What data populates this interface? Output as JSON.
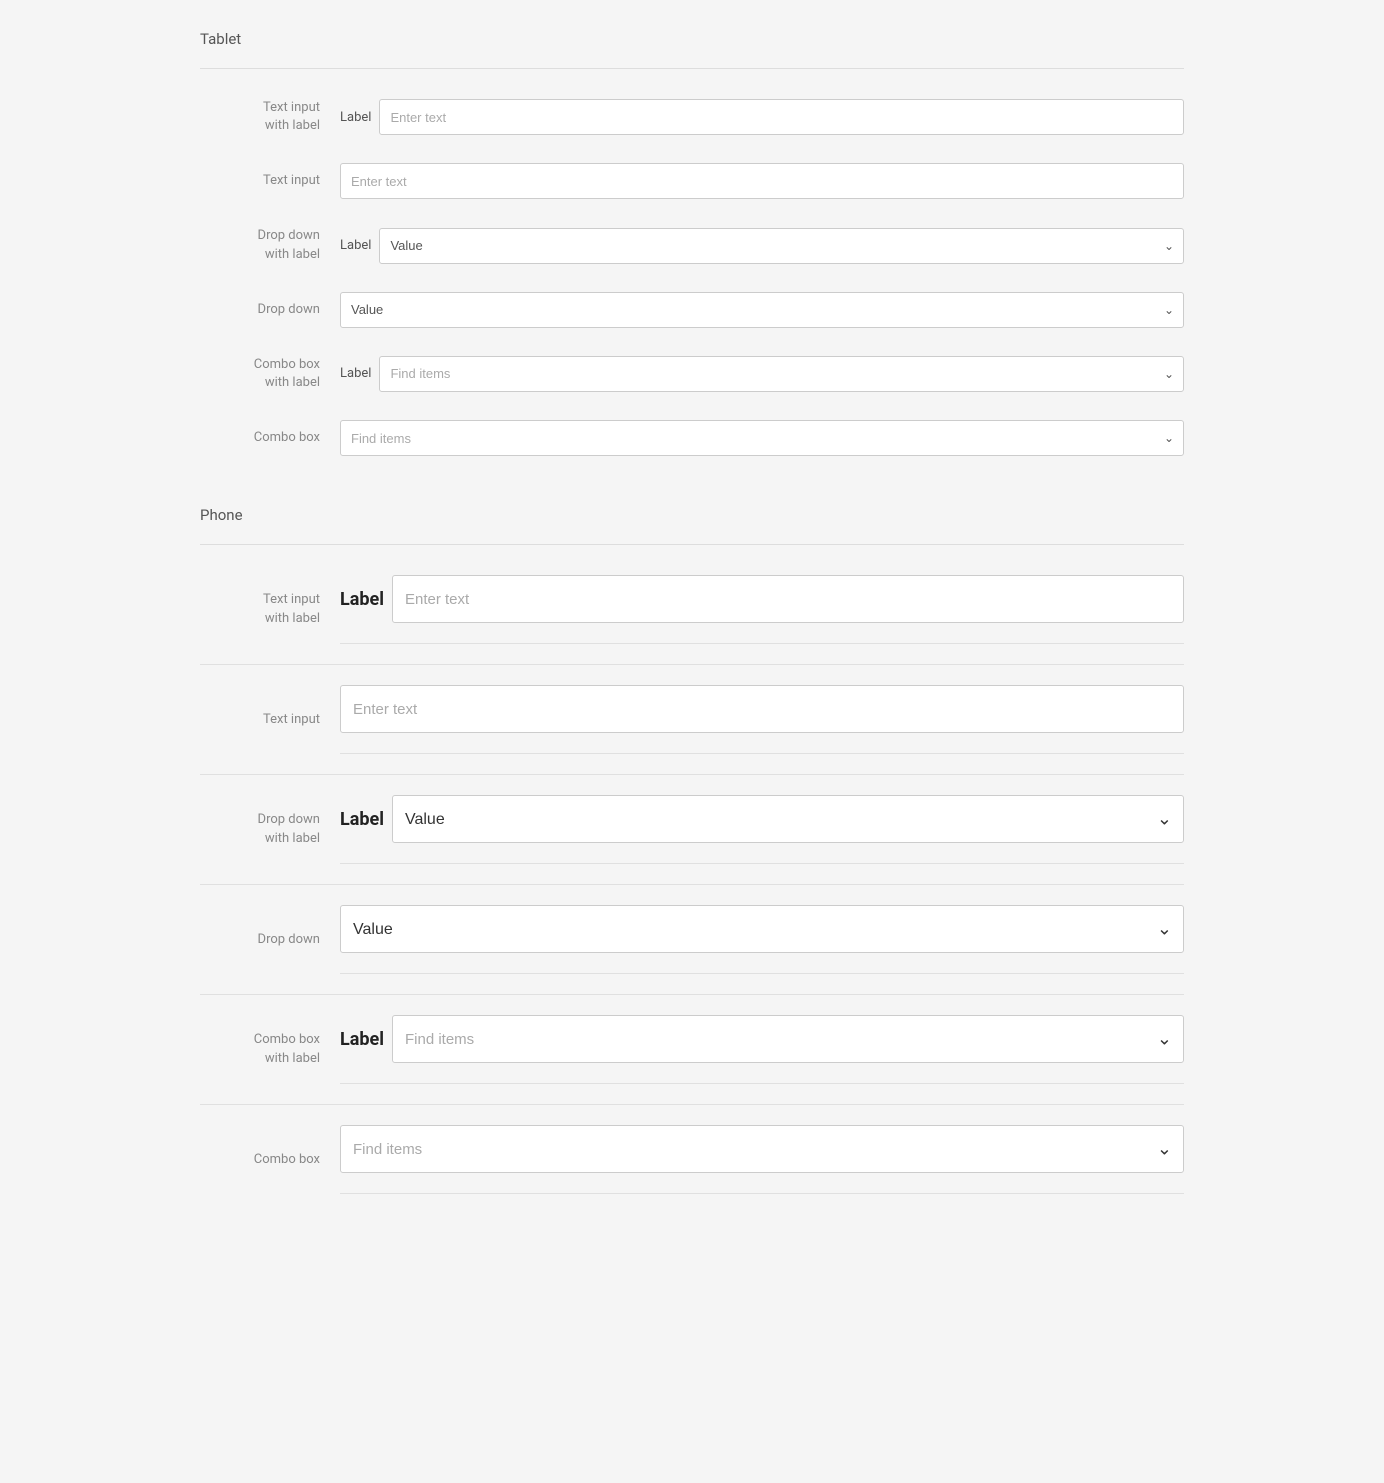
{
  "tablet": {
    "title": "Tablet",
    "rows": [
      {
        "id": "text-input-with-label",
        "row_label": "Text input with label",
        "type": "text-with-label",
        "inline_label": "Label",
        "placeholder": "Enter text"
      },
      {
        "id": "text-input",
        "row_label": "Text input",
        "type": "text",
        "placeholder": "Enter text"
      },
      {
        "id": "dropdown-with-label",
        "row_label": "Drop down with label",
        "type": "dropdown-with-label",
        "inline_label": "Label",
        "value": "Value"
      },
      {
        "id": "dropdown",
        "row_label": "Drop down",
        "type": "dropdown",
        "value": "Value"
      },
      {
        "id": "combobox-with-label",
        "row_label": "Combo box with label",
        "type": "combobox-with-label",
        "inline_label": "Label",
        "placeholder": "Find items"
      },
      {
        "id": "combobox",
        "row_label": "Combo box",
        "type": "combobox",
        "placeholder": "Find items"
      }
    ]
  },
  "phone": {
    "title": "Phone",
    "rows": [
      {
        "id": "phone-text-input-with-label",
        "row_label": "Text input with label",
        "type": "text-with-label",
        "inline_label": "Label",
        "placeholder": "Enter text"
      },
      {
        "id": "phone-text-input",
        "row_label": "Text input",
        "type": "text",
        "placeholder": "Enter text"
      },
      {
        "id": "phone-dropdown-with-label",
        "row_label": "Drop down with label",
        "type": "dropdown-with-label",
        "inline_label": "Label",
        "value": "Value"
      },
      {
        "id": "phone-dropdown",
        "row_label": "Drop down",
        "type": "dropdown",
        "value": "Value"
      },
      {
        "id": "phone-combobox-with-label",
        "row_label": "Combo box with label",
        "type": "combobox-with-label",
        "inline_label": "Label",
        "placeholder": "Find items"
      },
      {
        "id": "phone-combobox",
        "row_label": "Combo box",
        "type": "combobox",
        "placeholder": "Find items"
      }
    ]
  },
  "icons": {
    "chevron": "&#10661;"
  }
}
